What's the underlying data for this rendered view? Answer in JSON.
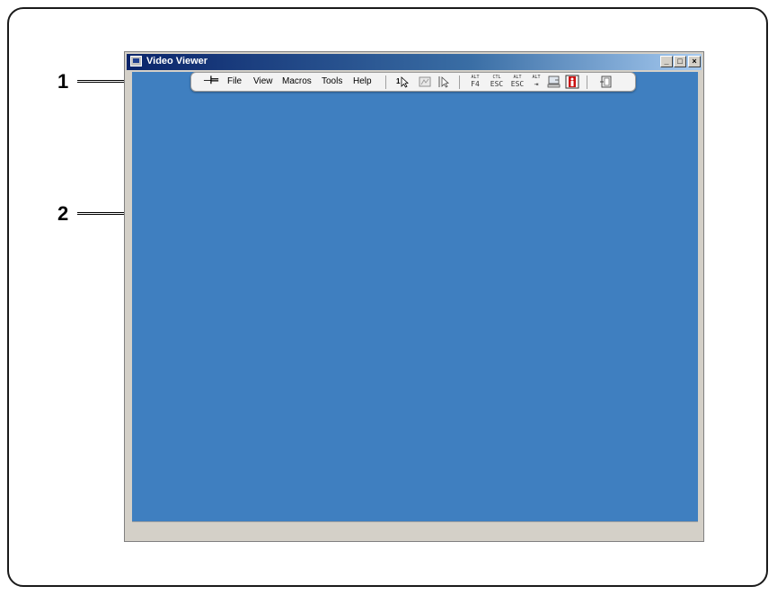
{
  "window": {
    "title": "Video Viewer"
  },
  "callouts": {
    "one": "1",
    "two": "2"
  },
  "menu": {
    "file": "File",
    "view": "View",
    "macros": "Macros",
    "tools": "Tools",
    "help": "Help"
  },
  "keys": [
    {
      "top": "ALT",
      "bottom": "F4"
    },
    {
      "top": "CTL",
      "bottom": "ESC"
    },
    {
      "top": "ALT",
      "bottom": "ESC"
    },
    {
      "top": "ALT",
      "bottom": "⇥"
    }
  ],
  "icons": {
    "pin": "pin-icon",
    "single_cursor": "single-cursor-icon",
    "refresh": "refresh-video-icon",
    "align_cursor": "align-cursor-icon",
    "switch": "switch-icon",
    "power": "power-icon",
    "exit": "exit-icon"
  },
  "colors": {
    "desktop": "#3f7fc0",
    "titlebar": "#0a246a",
    "toolbar": "#f3f3f3",
    "power_red": "#cc1111"
  }
}
